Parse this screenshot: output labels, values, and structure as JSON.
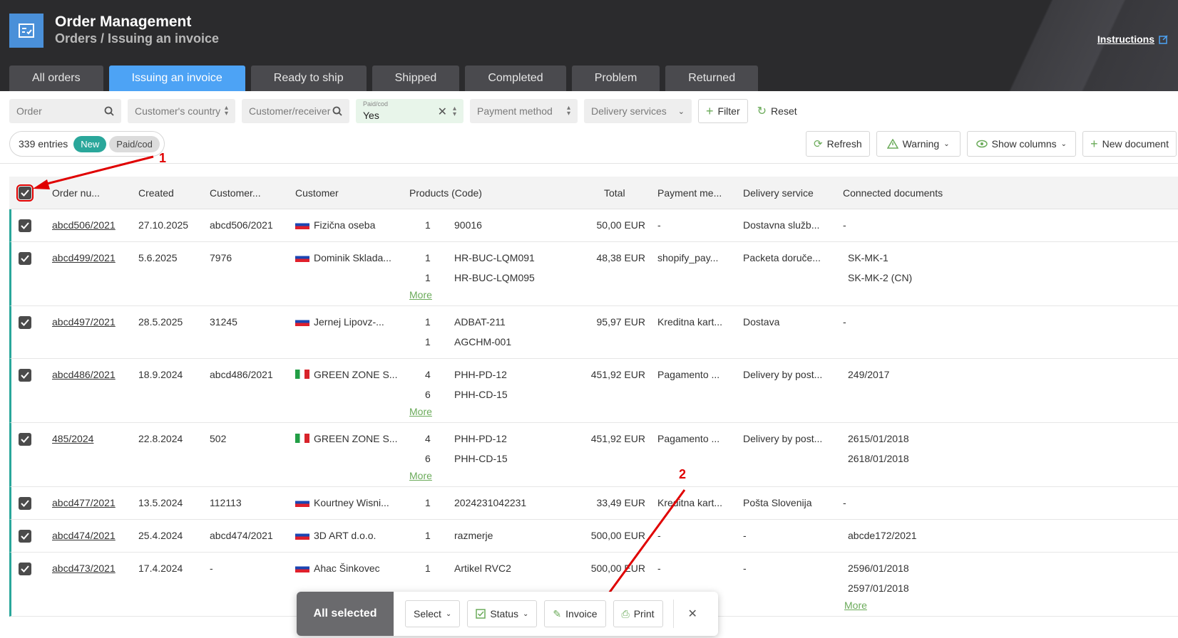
{
  "header": {
    "title": "Order Management",
    "subtitle": "Orders / Issuing an invoice",
    "instructions": "Instructions"
  },
  "tabs": [
    {
      "label": "All orders",
      "active": false
    },
    {
      "label": "Issuing an invoice",
      "active": true
    },
    {
      "label": "Ready to ship",
      "active": false
    },
    {
      "label": "Shipped",
      "active": false
    },
    {
      "label": "Completed",
      "active": false
    },
    {
      "label": "Problem",
      "active": false
    },
    {
      "label": "Returned",
      "active": false
    }
  ],
  "filters": {
    "order_placeholder": "Order",
    "country_placeholder": "Customer's country",
    "receiver_placeholder": "Customer/receiver",
    "paidcod_label": "Paid/cod",
    "paidcod_value": "Yes",
    "payment_placeholder": "Payment method",
    "delivery_placeholder": "Delivery services",
    "filter_button": "Filter",
    "reset_button": "Reset"
  },
  "summary": {
    "entries": "339 entries",
    "chip_new": "New",
    "chip_paid": "Paid/cod"
  },
  "toolbar": {
    "refresh": "Refresh",
    "warning": "Warning",
    "show_columns": "Show columns",
    "new_document": "New document"
  },
  "columns": {
    "order_number": "Order nu...",
    "created": "Created",
    "customer_id": "Customer...",
    "customer": "Customer",
    "products": "Products (Code)",
    "total": "Total",
    "payment": "Payment me...",
    "delivery": "Delivery service",
    "documents": "Connected documents"
  },
  "rows": [
    {
      "order": "abcd506/2021",
      "created": "27.10.2025",
      "cust_id": "abcd506/2021",
      "flag": "si",
      "customer": "Fizična oseba",
      "qty": [
        "1"
      ],
      "codes": [
        "90016"
      ],
      "more": "",
      "total": "50,00 EUR",
      "payment": "-",
      "delivery": "Dostavna služb...",
      "docs": [
        "-"
      ],
      "docs_more": ""
    },
    {
      "order": "abcd499/2021",
      "created": "5.6.2025",
      "cust_id": "7976",
      "flag": "sk",
      "customer": "Dominik Sklada...",
      "qty": [
        "1",
        "1"
      ],
      "codes": [
        "HR-BUC-LQM091",
        "HR-BUC-LQM095"
      ],
      "more": "More",
      "total": "48,38 EUR",
      "payment": "shopify_pay...",
      "delivery": "Packeta doruče...",
      "docs": [
        "SK-MK-1",
        "SK-MK-2 (CN)"
      ],
      "docs_more": ""
    },
    {
      "order": "abcd497/2021",
      "created": "28.5.2025",
      "cust_id": "31245",
      "flag": "si",
      "customer": "Jernej Lipovz-...",
      "qty": [
        "1",
        "1"
      ],
      "codes": [
        "ADBAT-211",
        "AGCHM-001"
      ],
      "more": "",
      "total": "95,97 EUR",
      "payment": "Kreditna kart...",
      "delivery": "Dostava",
      "docs": [
        "-"
      ],
      "docs_more": ""
    },
    {
      "order": "abcd486/2021",
      "created": "18.9.2024",
      "cust_id": "abcd486/2021",
      "flag": "it",
      "customer": "GREEN ZONE S...",
      "qty": [
        "4",
        "6"
      ],
      "codes": [
        "PHH-PD-12",
        "PHH-CD-15"
      ],
      "more": "More",
      "total": "451,92 EUR",
      "payment": "Pagamento ...",
      "delivery": "Delivery by post...",
      "docs": [
        "249/2017"
      ],
      "docs_more": ""
    },
    {
      "order": "485/2024",
      "created": "22.8.2024",
      "cust_id": "502",
      "flag": "it",
      "customer": "GREEN ZONE S...",
      "qty": [
        "4",
        "6"
      ],
      "codes": [
        "PHH-PD-12",
        "PHH-CD-15"
      ],
      "more": "More",
      "total": "451,92 EUR",
      "payment": "Pagamento ...",
      "delivery": "Delivery by post...",
      "docs": [
        "2615/01/2018",
        "2618/01/2018"
      ],
      "docs_more": ""
    },
    {
      "order": "abcd477/2021",
      "created": "13.5.2024",
      "cust_id": "112113",
      "flag": "si",
      "customer": "Kourtney Wisni...",
      "qty": [
        "1"
      ],
      "codes": [
        "2024231042231"
      ],
      "more": "",
      "total": "33,49 EUR",
      "payment": "Kreditna kart...",
      "delivery": "Pošta Slovenija",
      "docs": [
        "-"
      ],
      "docs_more": ""
    },
    {
      "order": "abcd474/2021",
      "created": "25.4.2024",
      "cust_id": "abcd474/2021",
      "flag": "si",
      "customer": "3D ART d.o.o.",
      "qty": [
        "1"
      ],
      "codes": [
        "razmerje"
      ],
      "more": "",
      "total": "500,00 EUR",
      "payment": "-",
      "delivery": "-",
      "docs": [
        "abcde172/2021"
      ],
      "docs_more": ""
    },
    {
      "order": "abcd473/2021",
      "created": "17.4.2024",
      "cust_id": "-",
      "flag": "si",
      "customer": "Ahac Šinkovec",
      "qty": [
        "1"
      ],
      "codes": [
        "Artikel RVC2"
      ],
      "more": "",
      "total": "500,00 EUR",
      "payment": "-",
      "delivery": "-",
      "docs": [
        "2596/01/2018",
        "2597/01/2018"
      ],
      "docs_more": "More"
    }
  ],
  "bulk": {
    "all_selected": "All selected",
    "select": "Select",
    "status": "Status",
    "invoice": "Invoice",
    "print": "Print"
  },
  "annotations": {
    "a1": "1",
    "a2": "2"
  },
  "colors": {
    "accent": "#4da3f5",
    "teal": "#2aa79b",
    "header_bg": "#2b2b2d",
    "annotation": "#e00000"
  }
}
